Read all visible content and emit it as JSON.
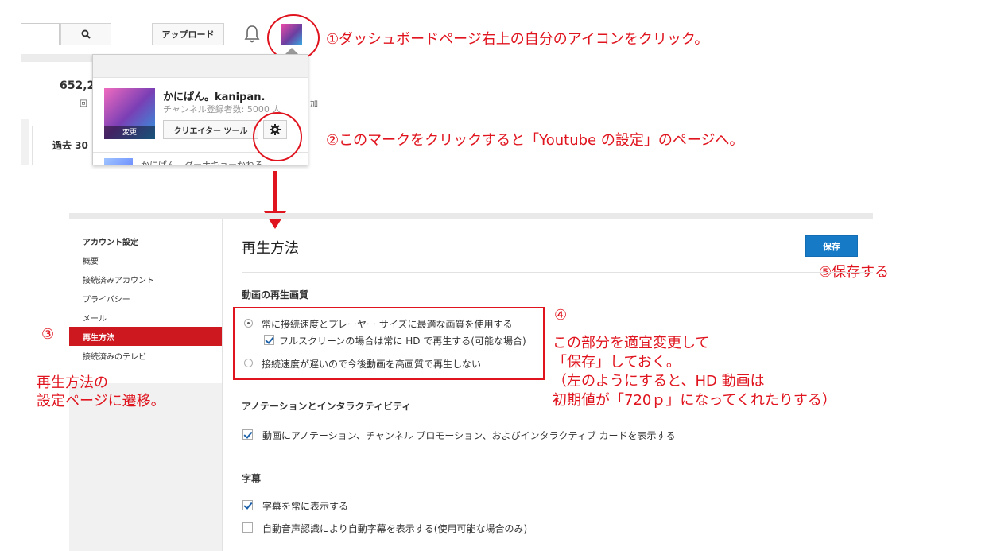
{
  "top": {
    "upload_label": "アップロード",
    "stat_value": "652,2",
    "stat_label": "回",
    "stat_label2": "加",
    "past_label": "過去 30",
    "dropdown": {
      "user_name": "かにぱん。kanipan.",
      "subscribers": "チャンネル登録者数: 5000 人",
      "avatar_change": "変更",
      "creator_tools": "クリエイター ツール",
      "cut_text": "かにぱん、ダーナキョーかねる"
    }
  },
  "annotations": {
    "step1": "①ダッシュボードページ右上の自分のアイコンをクリック。",
    "step2": "②このマークをクリックすると「Youtube の設定」のページへ。",
    "step3_num": "③",
    "step3_line1": "再生方法の",
    "step3_line2": "設定ページに遷移。",
    "step4_num": "④",
    "step4_line1": "この部分を適宜変更して",
    "step4_line2": "「保存」しておく。",
    "step4_line3": "（左のようにすると、HD 動画は",
    "step4_line4": "初期値が「720ｐ」になってくれたりする）",
    "step5": "⑤保存する"
  },
  "settings": {
    "nav": {
      "header": "アカウント設定",
      "items": [
        "概要",
        "接続済みアカウント",
        "プライバシー",
        "メール",
        "再生方法",
        "接続済みのテレビ"
      ],
      "active_index": 4
    },
    "title": "再生方法",
    "save_label": "保存",
    "quality": {
      "heading": "動画の再生画質",
      "opt_auto": "常に接続速度とプレーヤー サイズに最適な画質を使用する",
      "opt_fullscreen_hd": "フルスクリーンの場合は常に HD で再生する(可能な場合)",
      "opt_slow": "接続速度が遅いので今後動画を高画質で再生しない"
    },
    "annotations_section": {
      "heading": "アノテーションとインタラクティビティ",
      "opt_show": "動画にアノテーション、チャンネル プロモーション、およびインタラクティブ カードを表示する"
    },
    "subtitles": {
      "heading": "字幕",
      "opt_always": "字幕を常に表示する",
      "opt_auto": "自動音声認識により自動字幕を表示する(使用可能な場合のみ)"
    }
  },
  "colors": {
    "annotation_red": "#e0141e",
    "save_blue": "#167ac6",
    "nav_active": "#cc181e"
  }
}
